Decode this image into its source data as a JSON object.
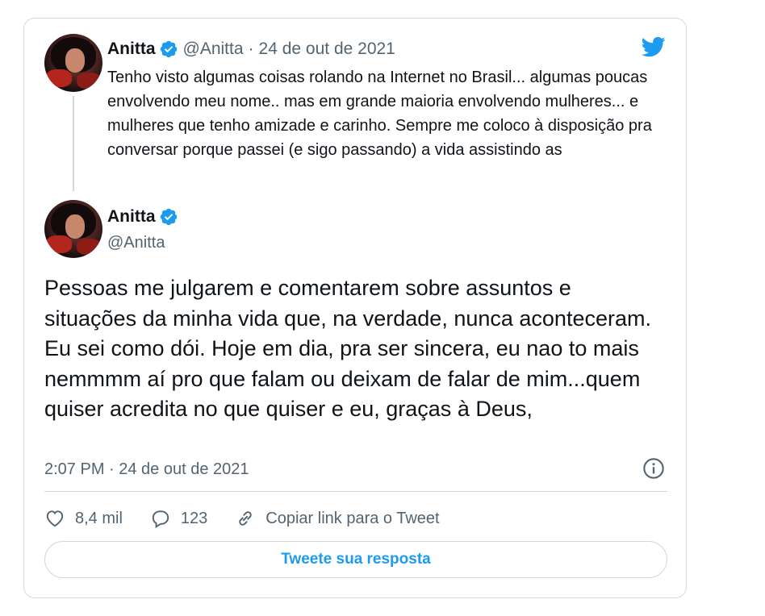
{
  "quoted_tweet": {
    "author_name": "Anitta",
    "handle": "@Anitta",
    "separator": "·",
    "date": "24 de out de 2021",
    "text": "Tenho visto algumas coisas rolando na Internet no Brasil... algumas poucas envolvendo meu nome.. mas em grande maioria envolvendo mulheres... e mulheres que tenho amizade e carinho. Sempre me coloco à disposição pra conversar porque passei (e sigo passando) a vida assistindo as"
  },
  "main_tweet": {
    "author_name": "Anitta",
    "handle": "@Anitta",
    "text": "Pessoas me julgarem e comentarem sobre assuntos e situações da minha vida que, na verdade, nunca aconteceram. Eu sei como dói. Hoje em dia, pra ser sincera, eu nao to mais nemmmm aí pro que falam ou deixam de falar de mim...quem quiser acredita no que quiser e eu, graças à Deus,",
    "timestamp": "2:07 PM · 24 de out de 2021"
  },
  "actions": {
    "likes": "8,4 mil",
    "replies": "123",
    "copy_link_label": "Copiar link para o Tweet"
  },
  "reply_button_label": "Tweete sua resposta",
  "icons": {
    "brand": "twitter-bird-icon",
    "verified": "verified-badge-icon",
    "info": "info-icon",
    "like": "heart-icon",
    "reply": "speech-bubble-icon",
    "link": "link-icon"
  },
  "colors": {
    "accent": "#1d9bf0",
    "secondary_text": "#536471",
    "border": "#cfd9de"
  }
}
